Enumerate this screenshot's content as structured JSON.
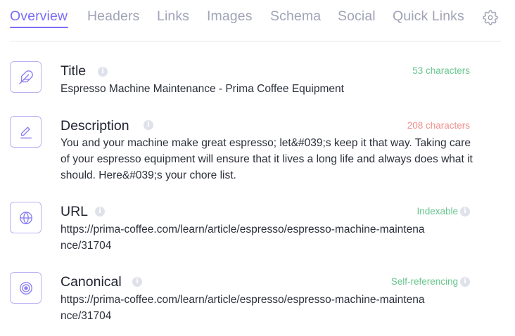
{
  "tabs": [
    {
      "label": "Overview",
      "active": true
    },
    {
      "label": "Headers",
      "active": false
    },
    {
      "label": "Links",
      "active": false
    },
    {
      "label": "Images",
      "active": false
    },
    {
      "label": "Schema",
      "active": false
    },
    {
      "label": "Social",
      "active": false
    },
    {
      "label": "Quick Links",
      "active": false
    }
  ],
  "settings_icon": "gear-icon",
  "colors": {
    "accent": "#7b6ef6",
    "inactive_tab": "#a1a3b7",
    "good": "#68c58e",
    "warning": "#f08f8c",
    "icon_border": "#b9b2f5"
  },
  "items": [
    {
      "icon": "feather-icon",
      "title": "Title",
      "status": "53 characters",
      "status_level": "good",
      "status_info": false,
      "value": "Espresso Machine Maintenance - Prima Coffee Equipment"
    },
    {
      "icon": "pencil-line-icon",
      "title": "Description",
      "status": "208 characters",
      "status_level": "warning",
      "status_info": false,
      "value": "You and your machine make great espresso; let&#039;s keep it that way. Taking care of your espresso equipment will ensure that it lives a long life and always does what it should. Here&#039;s your chore list."
    },
    {
      "icon": "globe-icon",
      "title": "URL",
      "status": "Indexable",
      "status_level": "good",
      "status_info": true,
      "value": "https://prima-coffee.com/learn/article/espresso/espresso-machine-maintenance/31704"
    },
    {
      "icon": "target-icon",
      "title": "Canonical",
      "status": "Self-referencing",
      "status_level": "good",
      "status_info": true,
      "value": "https://prima-coffee.com/learn/article/espresso/espresso-machine-maintenance/31704"
    }
  ]
}
